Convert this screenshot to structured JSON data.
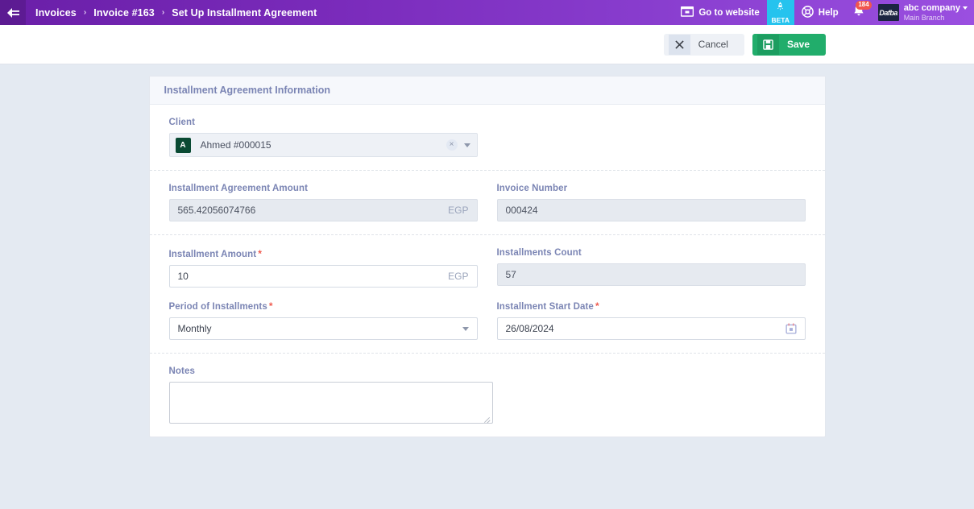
{
  "topbar": {
    "menu_icon": "collapse-sidebar-icon",
    "breadcrumb": [
      {
        "label": "Invoices"
      },
      {
        "label": "Invoice #163"
      },
      {
        "label": "Set Up Installment Agreement"
      }
    ],
    "separator": "›",
    "website_label": "Go to website",
    "beta_label": "BETA",
    "help_label": "Help",
    "notification_count": "184",
    "company_name": "abc company",
    "company_branch": "Main Branch",
    "company_logo_text": "Dafba"
  },
  "actions": {
    "cancel_label": "Cancel",
    "save_label": "Save"
  },
  "card": {
    "title": "Installment Agreement Information"
  },
  "form": {
    "client": {
      "label": "Client",
      "avatar_initial": "A",
      "value": "Ahmed #000015",
      "clear_glyph": "×"
    },
    "agreement_amount": {
      "label": "Installment Agreement Amount",
      "value": "565.42056074766",
      "currency": "EGP"
    },
    "invoice_number": {
      "label": "Invoice Number",
      "value": "000424"
    },
    "installment_amount": {
      "label": "Installment Amount",
      "required": "*",
      "value": "10",
      "currency": "EGP"
    },
    "installments_count": {
      "label": "Installments Count",
      "value": "57"
    },
    "period": {
      "label": "Period of Installments",
      "required": "*",
      "value": "Monthly"
    },
    "start_date": {
      "label": "Installment Start Date",
      "required": "*",
      "value": "26/08/2024"
    },
    "notes": {
      "label": "Notes",
      "value": ""
    }
  },
  "colors": {
    "brand_purple": "#7a2bbb",
    "beta_cyan": "#25c3ee",
    "save_green": "#21ad6b",
    "required_red": "#ef5b4f",
    "label_blue": "#7b85b4",
    "page_bg": "#e4eaf2"
  }
}
